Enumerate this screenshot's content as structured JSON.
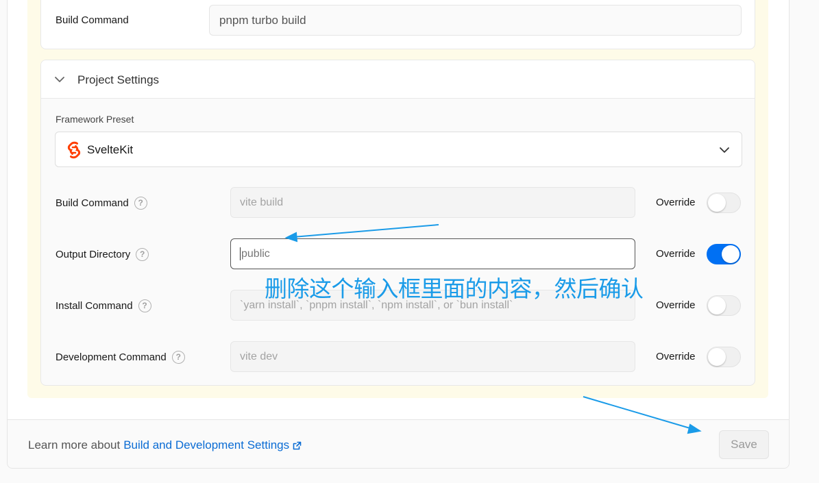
{
  "top_panel": {
    "build_command_label": "Build Command",
    "build_command_value": "pnpm turbo build"
  },
  "project_settings": {
    "title": "Project Settings",
    "framework_preset_label": "Framework Preset",
    "framework_preset_value": "SvelteKit",
    "framework_icon": "svelte-logo-icon",
    "rows": [
      {
        "label": "Build Command",
        "placeholder": "vite build",
        "value": "",
        "override_label": "Override",
        "override_on": false
      },
      {
        "label": "Output Directory",
        "placeholder": "",
        "value": "public",
        "override_label": "Override",
        "override_on": true
      },
      {
        "label": "Install Command",
        "placeholder": "`yarn install`, `pnpm install`, `npm install`, or `bun install`",
        "value": "",
        "override_label": "Override",
        "override_on": false
      },
      {
        "label": "Development Command",
        "placeholder": "vite dev",
        "value": "",
        "override_label": "Override",
        "override_on": false
      }
    ]
  },
  "footer": {
    "learn_more_prefix": "Learn more about",
    "learn_more_link": "Build and Development Settings",
    "save_label": "Save"
  },
  "annotation": {
    "text": "删除这个输入框里面的内容，然后确认",
    "color": "#1a9be8"
  },
  "colors": {
    "accent": "#0070f3",
    "link": "#0a6cd4",
    "highlight_bg": "#fefbe8",
    "svelte_orange": "#ff3e00"
  }
}
